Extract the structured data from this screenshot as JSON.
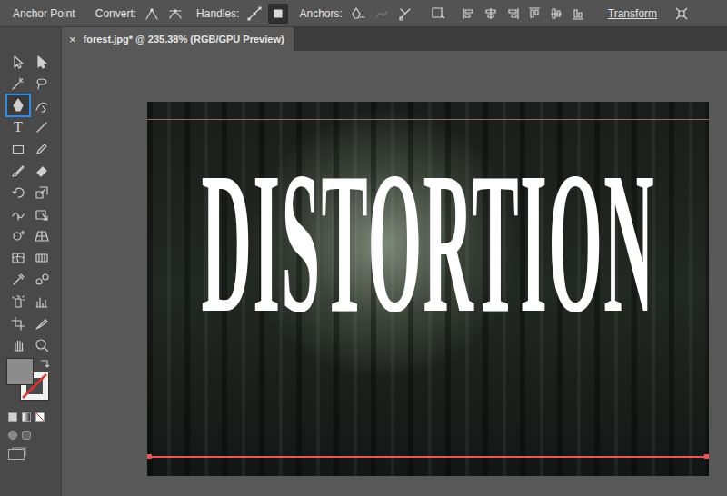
{
  "control_bar": {
    "title": "Anchor Point",
    "groups": [
      {
        "label": "Convert:",
        "buttons": [
          {
            "kind": "corner",
            "selected": false,
            "disabled": false
          },
          {
            "kind": "smooth",
            "selected": false,
            "disabled": false
          }
        ]
      },
      {
        "label": "Handles:",
        "buttons": [
          {
            "kind": "showhandles",
            "selected": false,
            "disabled": false
          },
          {
            "kind": "hidehandles",
            "selected": true,
            "disabled": false
          }
        ]
      },
      {
        "label": "Anchors:",
        "buttons": [
          {
            "kind": "remove",
            "selected": false,
            "disabled": false
          },
          {
            "kind": "connect",
            "selected": false,
            "disabled": true
          },
          {
            "kind": "cut",
            "selected": false,
            "disabled": false
          }
        ]
      }
    ],
    "transform": "Transform"
  },
  "document_tab": {
    "close": "×",
    "title": "forest.jpg* @ 235.38% (RGB/GPU Preview)",
    "selected": true
  },
  "toolbar": {
    "tools": [
      {
        "kind": "select",
        "selected": false
      },
      {
        "kind": "direct",
        "selected": false
      },
      {
        "kind": "wand",
        "selected": false
      },
      {
        "kind": "lasso",
        "selected": false
      },
      {
        "kind": "pen",
        "selected": true
      },
      {
        "kind": "curvature",
        "selected": false
      },
      {
        "kind": "type",
        "glyph": "T",
        "selected": false
      },
      {
        "kind": "line",
        "selected": false
      },
      {
        "kind": "rect",
        "selected": false
      },
      {
        "kind": "pencil",
        "selected": false
      },
      {
        "kind": "brush",
        "selected": false
      },
      {
        "kind": "eraser",
        "selected": false
      },
      {
        "kind": "rotate",
        "selected": false
      },
      {
        "kind": "scale",
        "selected": false
      },
      {
        "kind": "warp",
        "selected": false
      },
      {
        "kind": "freetransform",
        "selected": false
      },
      {
        "kind": "shapebuilder",
        "selected": false
      },
      {
        "kind": "perspective",
        "selected": false
      },
      {
        "kind": "mesh",
        "selected": false
      },
      {
        "kind": "gradient",
        "selected": false
      },
      {
        "kind": "eyedropper",
        "selected": false
      },
      {
        "kind": "blend",
        "selected": false
      },
      {
        "kind": "sprayer",
        "selected": false
      },
      {
        "kind": "graph",
        "selected": false
      },
      {
        "kind": "artboard",
        "selected": false
      },
      {
        "kind": "slice",
        "selected": false
      },
      {
        "kind": "hand",
        "selected": false
      },
      {
        "kind": "zoom",
        "selected": false
      }
    ],
    "fill": {
      "color": "#8c8c8c"
    },
    "stroke": {
      "none": true
    }
  },
  "artwork": {
    "text": "DISTORTION",
    "path_selected": true
  }
}
